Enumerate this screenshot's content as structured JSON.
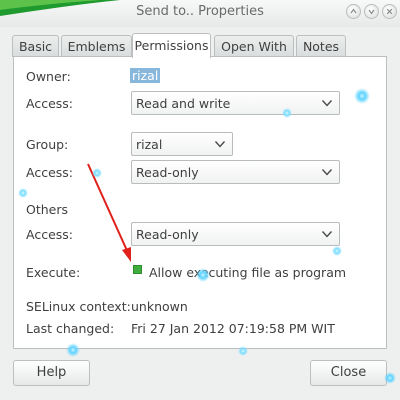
{
  "window": {
    "title": "Send to.. Properties"
  },
  "tabs": [
    {
      "label": "Basic"
    },
    {
      "label": "Emblems"
    },
    {
      "label": "Permissions"
    },
    {
      "label": "Open With"
    },
    {
      "label": "Notes"
    }
  ],
  "permissions": {
    "owner_label": "Owner:",
    "owner_value": "rizal",
    "owner_access_label": "Access:",
    "owner_access_value": "Read and write",
    "group_label": "Group:",
    "group_value": "rizal",
    "group_access_label": "Access:",
    "group_access_value": "Read-only",
    "others_label": "Others",
    "others_access_label": "Access:",
    "others_access_value": "Read-only",
    "execute_label": "Execute:",
    "execute_checkbox_label": "Allow executing file as program",
    "execute_checked": true,
    "selinux_label": "SELinux context:",
    "selinux_value": "unknown",
    "last_changed_label": "Last changed:",
    "last_changed_value": "Fri 27 Jan 2012 07:19:58 PM WIT"
  },
  "buttons": {
    "help_label": "Help",
    "close_label": "Close"
  },
  "colors": {
    "selection": "#88b7dc",
    "checkbox_checked": "#3fae3f",
    "annotation_arrow": "#e0201a",
    "sparkle": "#5fd3ff"
  },
  "icons": {
    "window_buttons": [
      "up-arrow-icon",
      "minimize-icon",
      "close-icon"
    ],
    "combo_arrow": "chevron-down-icon"
  }
}
